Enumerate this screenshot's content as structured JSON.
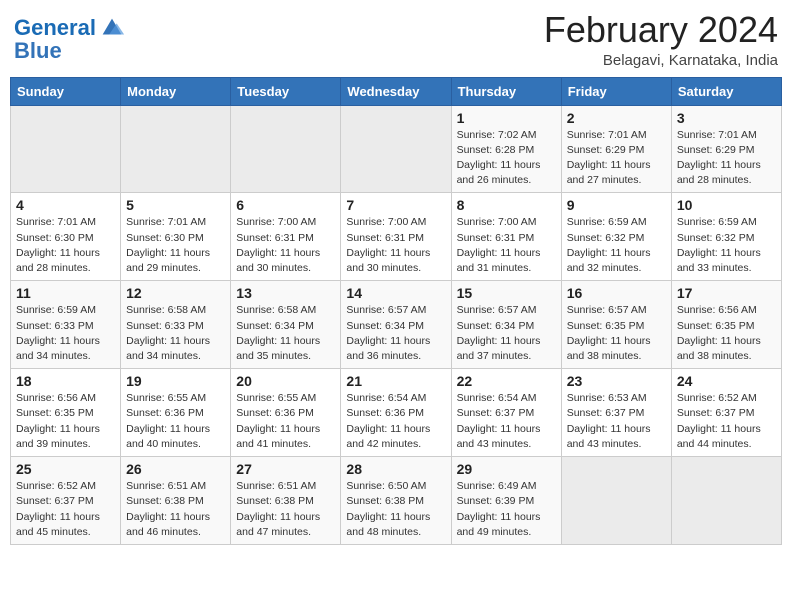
{
  "header": {
    "logo_line1": "General",
    "logo_line2": "Blue",
    "month_title": "February 2024",
    "subtitle": "Belagavi, Karnataka, India"
  },
  "weekdays": [
    "Sunday",
    "Monday",
    "Tuesday",
    "Wednesday",
    "Thursday",
    "Friday",
    "Saturday"
  ],
  "weeks": [
    [
      {
        "day": "",
        "sunrise": "",
        "sunset": "",
        "daylight": ""
      },
      {
        "day": "",
        "sunrise": "",
        "sunset": "",
        "daylight": ""
      },
      {
        "day": "",
        "sunrise": "",
        "sunset": "",
        "daylight": ""
      },
      {
        "day": "",
        "sunrise": "",
        "sunset": "",
        "daylight": ""
      },
      {
        "day": "1",
        "sunrise": "Sunrise: 7:02 AM",
        "sunset": "Sunset: 6:28 PM",
        "daylight": "Daylight: 11 hours and 26 minutes."
      },
      {
        "day": "2",
        "sunrise": "Sunrise: 7:01 AM",
        "sunset": "Sunset: 6:29 PM",
        "daylight": "Daylight: 11 hours and 27 minutes."
      },
      {
        "day": "3",
        "sunrise": "Sunrise: 7:01 AM",
        "sunset": "Sunset: 6:29 PM",
        "daylight": "Daylight: 11 hours and 28 minutes."
      }
    ],
    [
      {
        "day": "4",
        "sunrise": "Sunrise: 7:01 AM",
        "sunset": "Sunset: 6:30 PM",
        "daylight": "Daylight: 11 hours and 28 minutes."
      },
      {
        "day": "5",
        "sunrise": "Sunrise: 7:01 AM",
        "sunset": "Sunset: 6:30 PM",
        "daylight": "Daylight: 11 hours and 29 minutes."
      },
      {
        "day": "6",
        "sunrise": "Sunrise: 7:00 AM",
        "sunset": "Sunset: 6:31 PM",
        "daylight": "Daylight: 11 hours and 30 minutes."
      },
      {
        "day": "7",
        "sunrise": "Sunrise: 7:00 AM",
        "sunset": "Sunset: 6:31 PM",
        "daylight": "Daylight: 11 hours and 30 minutes."
      },
      {
        "day": "8",
        "sunrise": "Sunrise: 7:00 AM",
        "sunset": "Sunset: 6:31 PM",
        "daylight": "Daylight: 11 hours and 31 minutes."
      },
      {
        "day": "9",
        "sunrise": "Sunrise: 6:59 AM",
        "sunset": "Sunset: 6:32 PM",
        "daylight": "Daylight: 11 hours and 32 minutes."
      },
      {
        "day": "10",
        "sunrise": "Sunrise: 6:59 AM",
        "sunset": "Sunset: 6:32 PM",
        "daylight": "Daylight: 11 hours and 33 minutes."
      }
    ],
    [
      {
        "day": "11",
        "sunrise": "Sunrise: 6:59 AM",
        "sunset": "Sunset: 6:33 PM",
        "daylight": "Daylight: 11 hours and 34 minutes."
      },
      {
        "day": "12",
        "sunrise": "Sunrise: 6:58 AM",
        "sunset": "Sunset: 6:33 PM",
        "daylight": "Daylight: 11 hours and 34 minutes."
      },
      {
        "day": "13",
        "sunrise": "Sunrise: 6:58 AM",
        "sunset": "Sunset: 6:34 PM",
        "daylight": "Daylight: 11 hours and 35 minutes."
      },
      {
        "day": "14",
        "sunrise": "Sunrise: 6:57 AM",
        "sunset": "Sunset: 6:34 PM",
        "daylight": "Daylight: 11 hours and 36 minutes."
      },
      {
        "day": "15",
        "sunrise": "Sunrise: 6:57 AM",
        "sunset": "Sunset: 6:34 PM",
        "daylight": "Daylight: 11 hours and 37 minutes."
      },
      {
        "day": "16",
        "sunrise": "Sunrise: 6:57 AM",
        "sunset": "Sunset: 6:35 PM",
        "daylight": "Daylight: 11 hours and 38 minutes."
      },
      {
        "day": "17",
        "sunrise": "Sunrise: 6:56 AM",
        "sunset": "Sunset: 6:35 PM",
        "daylight": "Daylight: 11 hours and 38 minutes."
      }
    ],
    [
      {
        "day": "18",
        "sunrise": "Sunrise: 6:56 AM",
        "sunset": "Sunset: 6:35 PM",
        "daylight": "Daylight: 11 hours and 39 minutes."
      },
      {
        "day": "19",
        "sunrise": "Sunrise: 6:55 AM",
        "sunset": "Sunset: 6:36 PM",
        "daylight": "Daylight: 11 hours and 40 minutes."
      },
      {
        "day": "20",
        "sunrise": "Sunrise: 6:55 AM",
        "sunset": "Sunset: 6:36 PM",
        "daylight": "Daylight: 11 hours and 41 minutes."
      },
      {
        "day": "21",
        "sunrise": "Sunrise: 6:54 AM",
        "sunset": "Sunset: 6:36 PM",
        "daylight": "Daylight: 11 hours and 42 minutes."
      },
      {
        "day": "22",
        "sunrise": "Sunrise: 6:54 AM",
        "sunset": "Sunset: 6:37 PM",
        "daylight": "Daylight: 11 hours and 43 minutes."
      },
      {
        "day": "23",
        "sunrise": "Sunrise: 6:53 AM",
        "sunset": "Sunset: 6:37 PM",
        "daylight": "Daylight: 11 hours and 43 minutes."
      },
      {
        "day": "24",
        "sunrise": "Sunrise: 6:52 AM",
        "sunset": "Sunset: 6:37 PM",
        "daylight": "Daylight: 11 hours and 44 minutes."
      }
    ],
    [
      {
        "day": "25",
        "sunrise": "Sunrise: 6:52 AM",
        "sunset": "Sunset: 6:37 PM",
        "daylight": "Daylight: 11 hours and 45 minutes."
      },
      {
        "day": "26",
        "sunrise": "Sunrise: 6:51 AM",
        "sunset": "Sunset: 6:38 PM",
        "daylight": "Daylight: 11 hours and 46 minutes."
      },
      {
        "day": "27",
        "sunrise": "Sunrise: 6:51 AM",
        "sunset": "Sunset: 6:38 PM",
        "daylight": "Daylight: 11 hours and 47 minutes."
      },
      {
        "day": "28",
        "sunrise": "Sunrise: 6:50 AM",
        "sunset": "Sunset: 6:38 PM",
        "daylight": "Daylight: 11 hours and 48 minutes."
      },
      {
        "day": "29",
        "sunrise": "Sunrise: 6:49 AM",
        "sunset": "Sunset: 6:39 PM",
        "daylight": "Daylight: 11 hours and 49 minutes."
      },
      {
        "day": "",
        "sunrise": "",
        "sunset": "",
        "daylight": ""
      },
      {
        "day": "",
        "sunrise": "",
        "sunset": "",
        "daylight": ""
      }
    ]
  ]
}
